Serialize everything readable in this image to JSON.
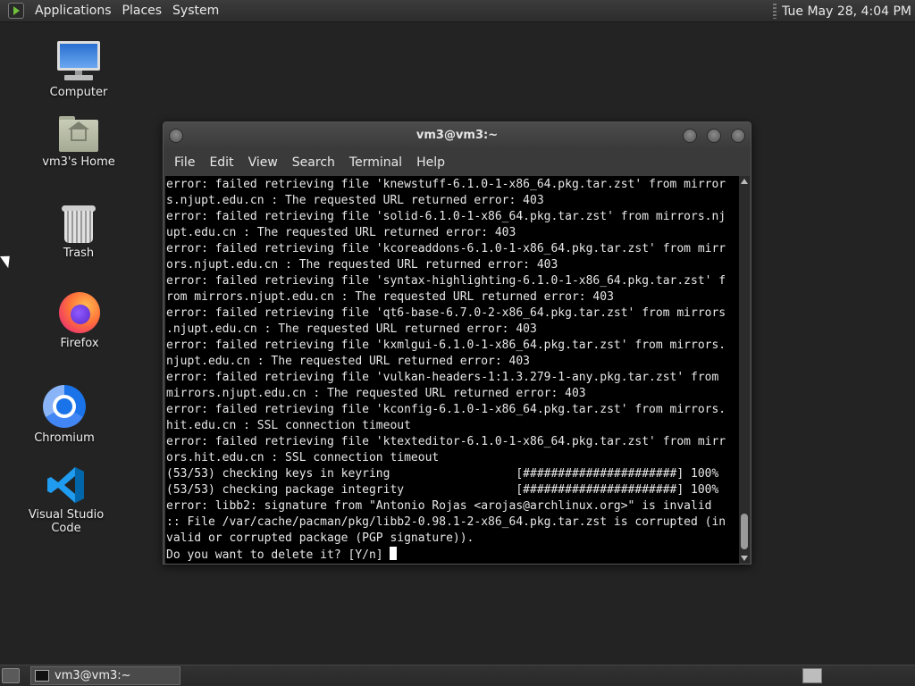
{
  "top_panel": {
    "menus": [
      "Applications",
      "Places",
      "System"
    ],
    "clock": "Tue May 28,  4:04 PM"
  },
  "desktop": {
    "icons": [
      {
        "label": "Computer",
        "icon": "computer-icon"
      },
      {
        "label": "vm3's Home",
        "icon": "home-folder-icon"
      },
      {
        "label": "Trash",
        "icon": "trash-icon"
      },
      {
        "label": "Firefox",
        "icon": "firefox-icon"
      },
      {
        "label": "Chromium",
        "icon": "chromium-icon"
      },
      {
        "label": "Visual Studio Code",
        "icon": "vscode-icon"
      }
    ]
  },
  "terminal": {
    "title": "vm3@vm3:~",
    "menu": [
      "File",
      "Edit",
      "View",
      "Search",
      "Terminal",
      "Help"
    ],
    "lines": [
      "error: failed retrieving file 'knewstuff-6.1.0-1-x86_64.pkg.tar.zst' from mirror",
      "s.njupt.edu.cn : The requested URL returned error: 403",
      "error: failed retrieving file 'solid-6.1.0-1-x86_64.pkg.tar.zst' from mirrors.nj",
      "upt.edu.cn : The requested URL returned error: 403",
      "error: failed retrieving file 'kcoreaddons-6.1.0-1-x86_64.pkg.tar.zst' from mirr",
      "ors.njupt.edu.cn : The requested URL returned error: 403",
      "error: failed retrieving file 'syntax-highlighting-6.1.0-1-x86_64.pkg.tar.zst' f",
      "rom mirrors.njupt.edu.cn : The requested URL returned error: 403",
      "error: failed retrieving file 'qt6-base-6.7.0-2-x86_64.pkg.tar.zst' from mirrors",
      ".njupt.edu.cn : The requested URL returned error: 403",
      "error: failed retrieving file 'kxmlgui-6.1.0-1-x86_64.pkg.tar.zst' from mirrors.",
      "njupt.edu.cn : The requested URL returned error: 403",
      "error: failed retrieving file 'vulkan-headers-1:1.3.279-1-any.pkg.tar.zst' from ",
      "mirrors.njupt.edu.cn : The requested URL returned error: 403",
      "error: failed retrieving file 'kconfig-6.1.0-1-x86_64.pkg.tar.zst' from mirrors.",
      "hit.edu.cn : SSL connection timeout",
      "error: failed retrieving file 'ktexteditor-6.1.0-1-x86_64.pkg.tar.zst' from mirr",
      "ors.hit.edu.cn : SSL connection timeout",
      "(53/53) checking keys in keyring                  [######################] 100%",
      "(53/53) checking package integrity                [######################] 100%",
      "error: libb2: signature from \"Antonio Rojas <arojas@archlinux.org>\" is invalid",
      ":: File /var/cache/pacman/pkg/libb2-0.98.1-2-x86_64.pkg.tar.zst is corrupted (in",
      "valid or corrupted package (PGP signature)).",
      "Do you want to delete it? [Y/n] "
    ]
  },
  "taskbar": {
    "task_label": "vm3@vm3:~"
  }
}
